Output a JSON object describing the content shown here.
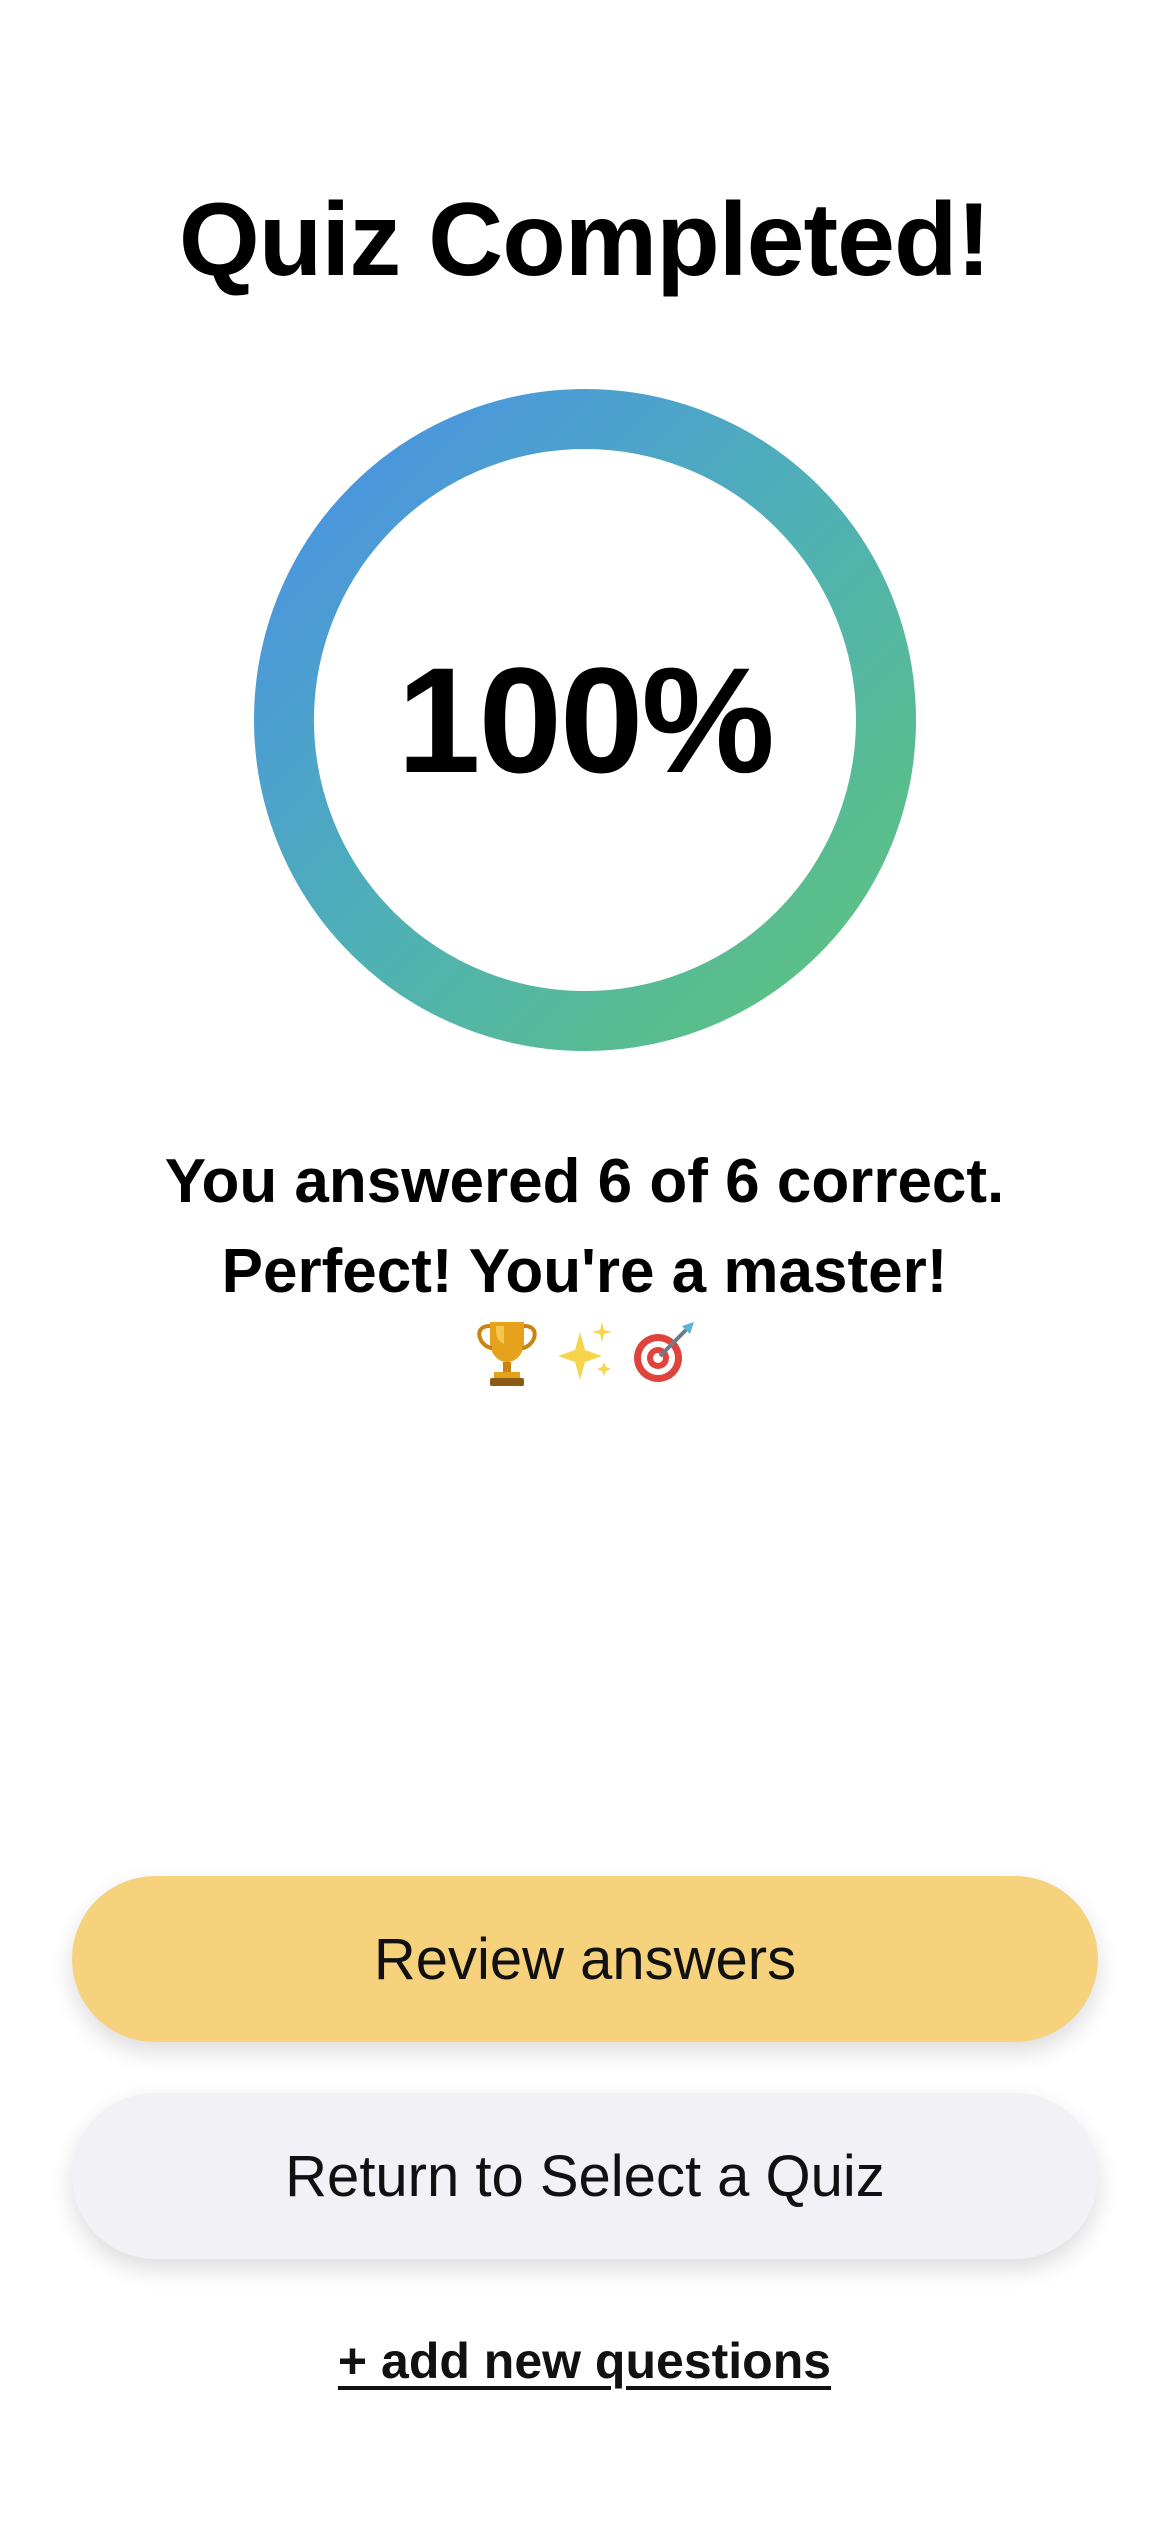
{
  "header": {
    "title": "Quiz Completed!"
  },
  "score": {
    "percent_label": "100%",
    "progress_fraction": 1.0,
    "gradient_colors": [
      "#5ec47a",
      "#4a8fe8"
    ]
  },
  "result": {
    "summary": "You answered 6 of 6 correct.",
    "message": "Perfect! You're a master!",
    "emojis": [
      "trophy-icon",
      "sparkles-icon",
      "bullseye-icon"
    ]
  },
  "actions": {
    "review_label": "Review answers",
    "return_label": "Return to Select a Quiz",
    "add_questions_label": "+ add new questions",
    "review_color": "#f6d27d",
    "return_color": "#f1f1f6"
  }
}
